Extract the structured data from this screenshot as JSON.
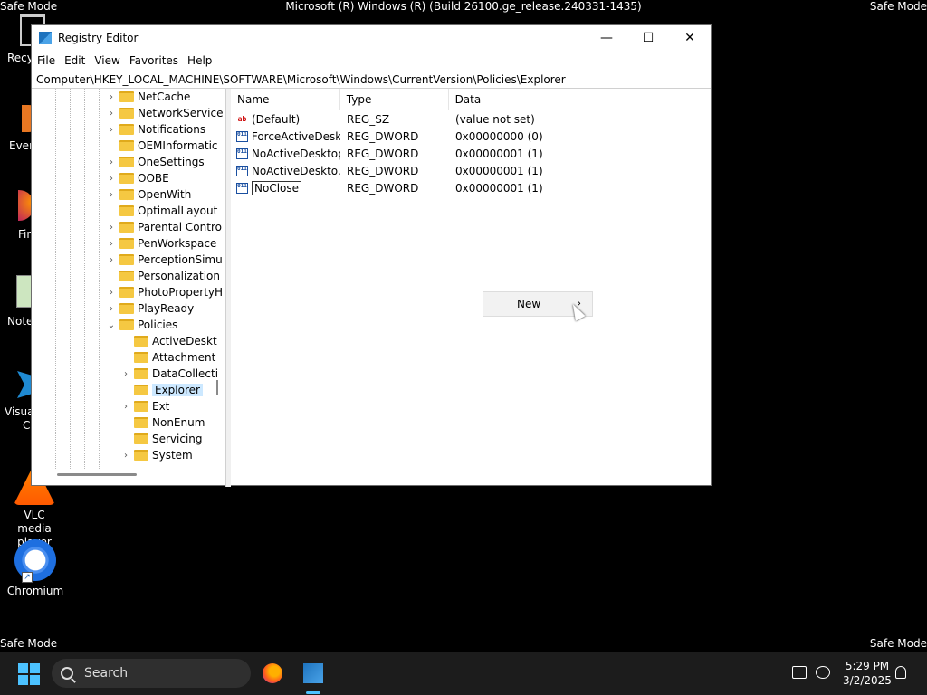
{
  "desktop": {
    "build_title": "Microsoft (R) Windows (R) (Build 26100.ge_release.240331-1435)",
    "safe_mode_label": "Safe Mode",
    "icons": [
      {
        "label": "Recy",
        "icon": "recycle-bin-icon"
      },
      {
        "label": "Ever",
        "icon": "everything-icon"
      },
      {
        "label": "Fir",
        "icon": "firefox-icon"
      },
      {
        "label": "Note",
        "icon": "notepad-icon"
      },
      {
        "label": "Visua",
        "icon": "vscode-icon"
      },
      {
        "label": "C",
        "icon": "vscode-icon"
      },
      {
        "label": "VLC media player",
        "icon": "vlc-icon"
      },
      {
        "label": "Chromium",
        "icon": "chromium-icon"
      }
    ]
  },
  "window": {
    "title": "Registry Editor",
    "controls": {
      "minimize": "—",
      "maximize": "☐",
      "close": "✕"
    },
    "menu": [
      "File",
      "Edit",
      "View",
      "Favorites",
      "Help"
    ],
    "address": "Computer\\HKEY_LOCAL_MACHINE\\SOFTWARE\\Microsoft\\Windows\\CurrentVersion\\Policies\\Explorer"
  },
  "tree": {
    "items": [
      {
        "label": "NetCache",
        "expandable": true
      },
      {
        "label": "NetworkService",
        "expandable": true
      },
      {
        "label": "Notifications",
        "expandable": true
      },
      {
        "label": "OEMInformatic",
        "expandable": false
      },
      {
        "label": "OneSettings",
        "expandable": true
      },
      {
        "label": "OOBE",
        "expandable": true
      },
      {
        "label": "OpenWith",
        "expandable": true
      },
      {
        "label": "OptimalLayout",
        "expandable": false
      },
      {
        "label": "Parental Contro",
        "expandable": true
      },
      {
        "label": "PenWorkspace",
        "expandable": true
      },
      {
        "label": "PerceptionSimu",
        "expandable": true
      },
      {
        "label": "Personalization",
        "expandable": false
      },
      {
        "label": "PhotoPropertyH",
        "expandable": true
      },
      {
        "label": "PlayReady",
        "expandable": true
      },
      {
        "label": "Policies",
        "expandable": true,
        "expanded": true
      },
      {
        "label": "ActiveDeskt",
        "expandable": false,
        "child": true
      },
      {
        "label": "Attachment",
        "expandable": false,
        "child": true
      },
      {
        "label": "DataCollecti",
        "expandable": true,
        "child": true
      },
      {
        "label": "Explorer",
        "expandable": false,
        "child": true,
        "selected": true
      },
      {
        "label": "Ext",
        "expandable": true,
        "child": true
      },
      {
        "label": "NonEnum",
        "expandable": false,
        "child": true
      },
      {
        "label": "Servicing",
        "expandable": false,
        "child": true
      },
      {
        "label": "System",
        "expandable": true,
        "child": true
      }
    ]
  },
  "list": {
    "columns": [
      "Name",
      "Type",
      "Data"
    ],
    "rows": [
      {
        "name": "(Default)",
        "type": "REG_SZ",
        "data": "(value not set)",
        "kind": "sz"
      },
      {
        "name": "ForceActiveDesk...",
        "type": "REG_DWORD",
        "data": "0x00000000 (0)",
        "kind": "dword"
      },
      {
        "name": "NoActiveDesktop",
        "type": "REG_DWORD",
        "data": "0x00000001 (1)",
        "kind": "dword"
      },
      {
        "name": "NoActiveDeskto...",
        "type": "REG_DWORD",
        "data": "0x00000001 (1)",
        "kind": "dword"
      },
      {
        "name": "NoClose",
        "type": "REG_DWORD",
        "data": "0x00000001 (1)",
        "kind": "dword",
        "editing": true
      }
    ]
  },
  "context_menu": {
    "items": [
      {
        "label": "New",
        "submenu": true
      }
    ],
    "arrow": "›"
  },
  "taskbar": {
    "search_placeholder": "Search",
    "apps": [
      "firefox-icon",
      "registry-editor-icon"
    ],
    "time": "5:29 PM",
    "date": "3/2/2025"
  }
}
